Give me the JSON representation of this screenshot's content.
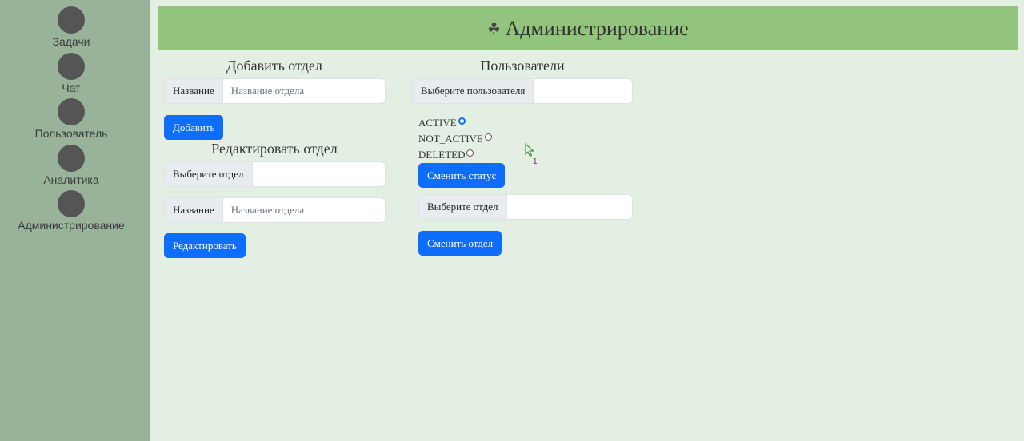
{
  "sidebar": {
    "items": [
      {
        "label": "Задачи"
      },
      {
        "label": "Чат"
      },
      {
        "label": "Пользователь"
      },
      {
        "label": "Аналитика"
      },
      {
        "label": "Администрирование"
      }
    ]
  },
  "header": {
    "icon": "admin-icon",
    "icon_glyph": "☘",
    "title": "Администрирование"
  },
  "add_department": {
    "title": "Добавить отдел",
    "name_label": "Название",
    "name_placeholder": "Название отдела",
    "name_value": "",
    "submit_label": "Добавить"
  },
  "edit_department": {
    "title": "Редактировать отдел",
    "select_label": "Выберите отдел",
    "select_value": "",
    "name_label": "Название",
    "name_placeholder": "Название отдела",
    "name_value": "",
    "submit_label": "Редактировать"
  },
  "users": {
    "title": "Пользователи",
    "select_user_label": "Выберите пользователя",
    "select_user_value": "",
    "statuses": [
      {
        "label": "ACTIVE",
        "checked": true
      },
      {
        "label": "NOT_ACTIVE",
        "checked": false
      },
      {
        "label": "DELETED",
        "checked": false
      }
    ],
    "change_status_label": "Сменить статус",
    "select_department_label": "Выберите отдел",
    "select_department_value": "",
    "change_department_label": "Сменить отдел"
  },
  "cursor": {
    "badge": "1"
  },
  "colors": {
    "sidebar_bg": "#98b39a",
    "header_bg": "#93c47d",
    "page_bg": "#e4efe3",
    "button_primary": "#0d6efd"
  }
}
